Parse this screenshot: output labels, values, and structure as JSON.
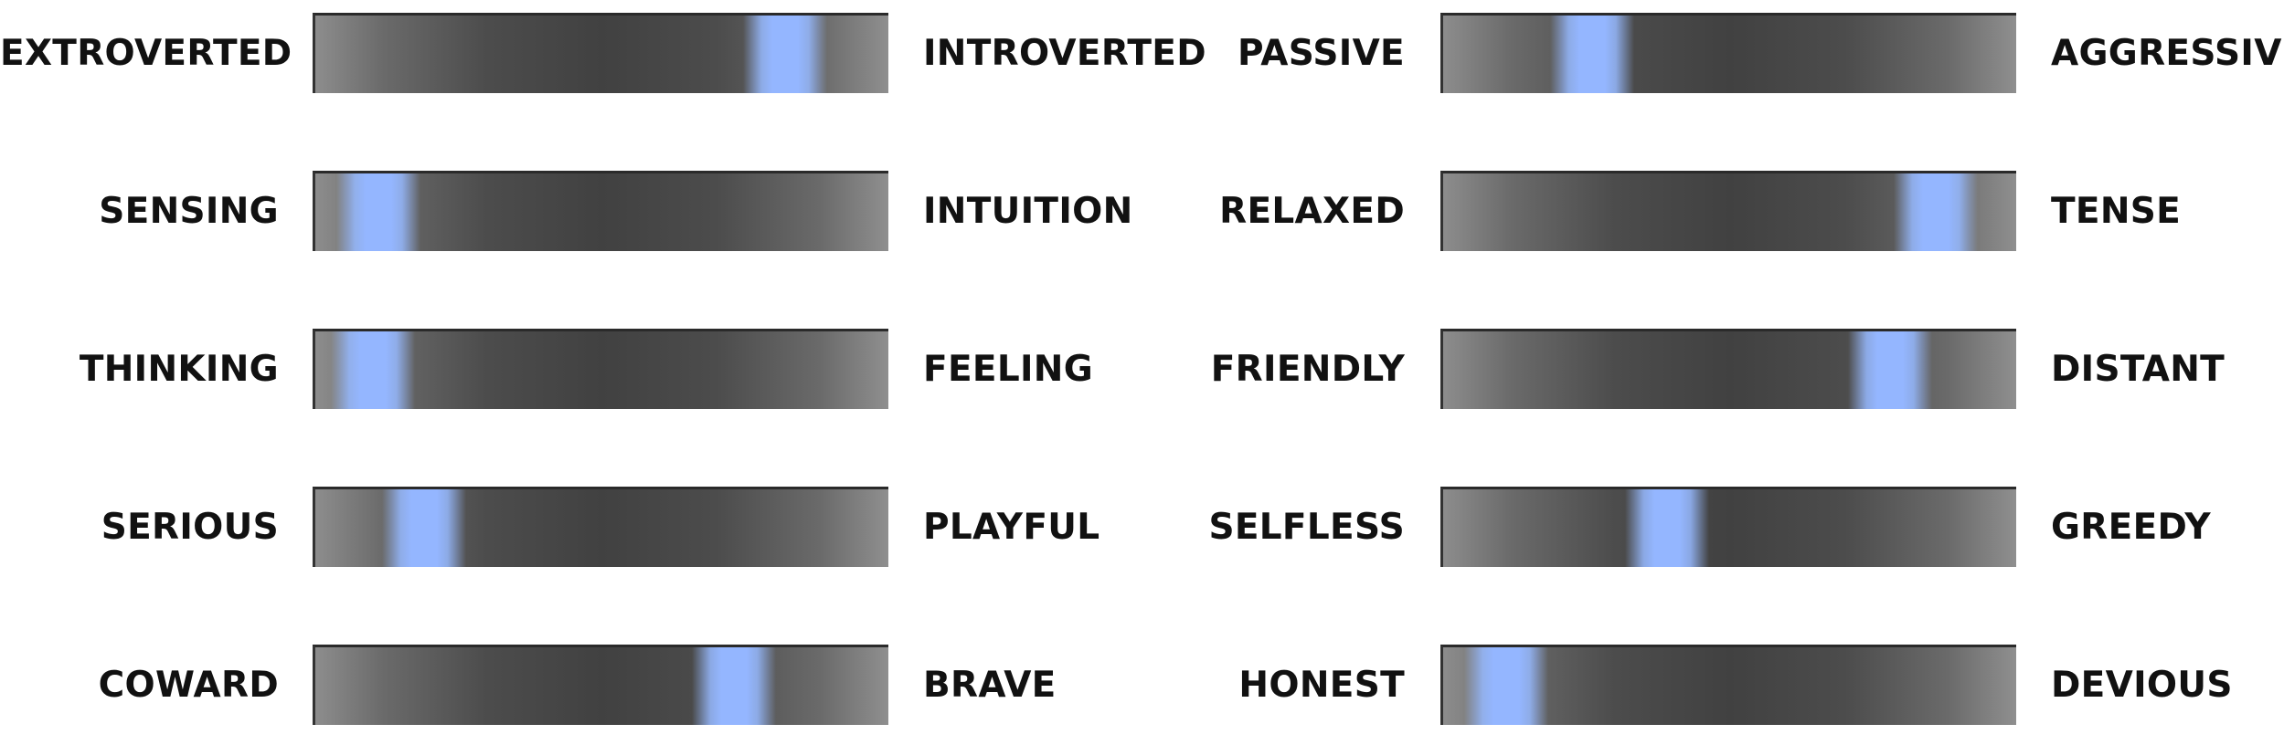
{
  "traits": {
    "left": [
      {
        "low": "EXTROVERTED",
        "high": "INTROVERTED",
        "level": 0.82
      },
      {
        "low": "SENSING",
        "high": "INTUITION",
        "level": 0.11
      },
      {
        "low": "THINKING",
        "high": "FEELING",
        "level": 0.1
      },
      {
        "low": "SERIOUS",
        "high": "PLAYFUL",
        "level": 0.19
      },
      {
        "low": "COWARD",
        "high": "BRAVE",
        "level": 0.73
      }
    ],
    "right": [
      {
        "low": "PASSIVE",
        "high": "AGGRESSIVE",
        "level": 0.26
      },
      {
        "low": "RELAXED",
        "high": "TENSE",
        "level": 0.86
      },
      {
        "low": "FRIENDLY",
        "high": "DISTANT",
        "level": 0.78
      },
      {
        "low": "SELFLESS",
        "high": "GREEDY",
        "level": 0.39
      },
      {
        "low": "HONEST",
        "high": "DEVIOUS",
        "level": 0.11
      }
    ]
  },
  "colors": {
    "marker": "#94b6ff",
    "track_dark": "#414141",
    "track_light": "#8d8d8d",
    "label_text": "#111111"
  }
}
